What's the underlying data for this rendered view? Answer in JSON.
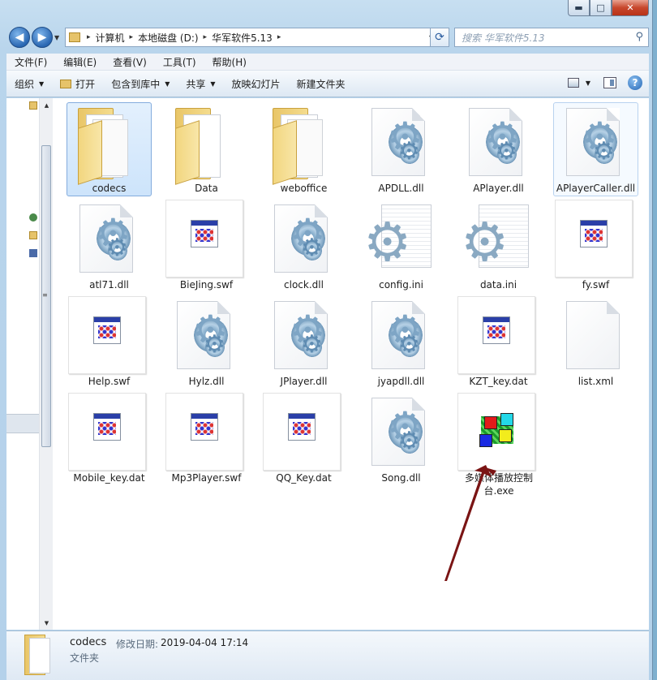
{
  "window": {
    "controls": {
      "minimize": "▬",
      "maximize": "□",
      "close": "✕"
    }
  },
  "address": {
    "crumbs": [
      "计算机",
      "本地磁盘 (D:)",
      "华军软件5.13"
    ],
    "separator": "▸",
    "dropdown": "▾"
  },
  "search": {
    "placeholder": "搜索 华军软件5.13",
    "icon": "search-icon"
  },
  "menu": [
    "文件(F)",
    "编辑(E)",
    "查看(V)",
    "工具(T)",
    "帮助(H)"
  ],
  "toolbar": {
    "organize": "组织",
    "open": "打开",
    "include_library": "包含到库中",
    "share": "共享",
    "slideshow": "放映幻灯片",
    "new_folder": "新建文件夹",
    "dropdown_arrow": "▼",
    "help": "?"
  },
  "files": [
    {
      "name": "codecs",
      "type": "folder",
      "selected": true
    },
    {
      "name": "Data",
      "type": "folder-empty"
    },
    {
      "name": "weboffice",
      "type": "folder"
    },
    {
      "name": "APDLL.dll",
      "type": "dll"
    },
    {
      "name": "APlayer.dll",
      "type": "dll"
    },
    {
      "name": "APlayerCaller.dll",
      "type": "dll",
      "hover": true
    },
    {
      "name": "atl71.dll",
      "type": "dll"
    },
    {
      "name": "BieJing.swf",
      "type": "swf"
    },
    {
      "name": "clock.dll",
      "type": "dll"
    },
    {
      "name": "config.ini",
      "type": "ini"
    },
    {
      "name": "data.ini",
      "type": "ini"
    },
    {
      "name": "fy.swf",
      "type": "swf"
    },
    {
      "name": "Help.swf",
      "type": "swf"
    },
    {
      "name": "Hylz.dll",
      "type": "dll"
    },
    {
      "name": "JPlayer.dll",
      "type": "dll"
    },
    {
      "name": "jyapdll.dll",
      "type": "dll"
    },
    {
      "name": "KZT_key.dat",
      "type": "swf"
    },
    {
      "name": "list.xml",
      "type": "blank"
    },
    {
      "name": "Mobile_key.dat",
      "type": "swf"
    },
    {
      "name": "Mp3Player.swf",
      "type": "swf"
    },
    {
      "name": "QQ_Key.dat",
      "type": "swf"
    },
    {
      "name": "Song.dll",
      "type": "dll"
    },
    {
      "name": "多媒体播放控制台.exe",
      "type": "exe"
    }
  ],
  "details": {
    "name": "codecs",
    "modified_label": "修改日期:",
    "modified_value": "2019-04-04 17:14",
    "type": "文件夹"
  },
  "colors": {
    "selection": "#cde4fb",
    "arrow": "#7a1414",
    "accent": "#2a67b2"
  }
}
